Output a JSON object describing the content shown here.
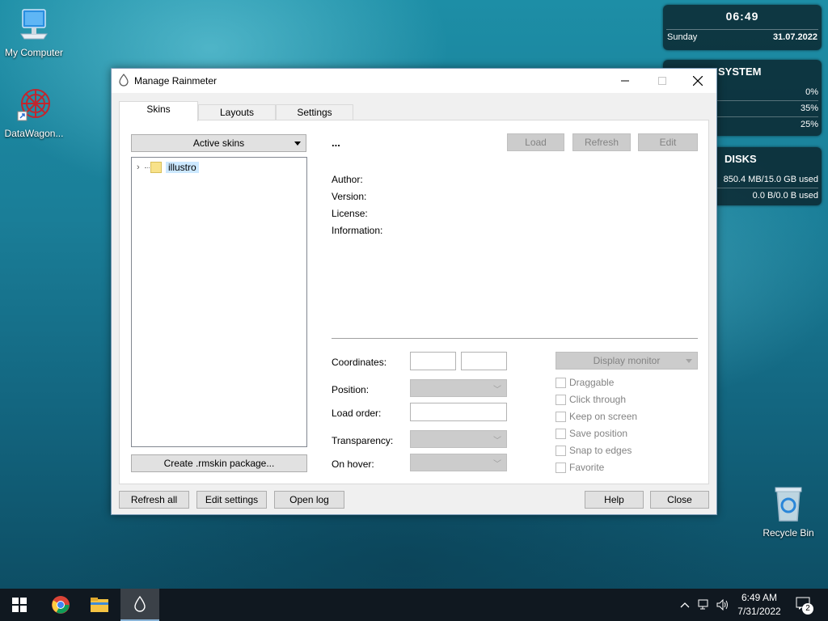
{
  "desktop": {
    "icons": [
      {
        "label": "My Computer"
      },
      {
        "label": "DataWagon..."
      },
      {
        "label": "Recycle Bin"
      }
    ]
  },
  "widgets": {
    "clock": {
      "time": "06:49",
      "day": "Sunday",
      "date": "31.07.2022"
    },
    "system": {
      "title": "SYSTEM",
      "values": [
        "0%",
        "35%",
        "25%"
      ]
    },
    "disks": {
      "title": "DISKS",
      "values": [
        "850.4 MB/15.0 GB used",
        "0.0 B/0.0 B used"
      ]
    }
  },
  "window": {
    "title": "Manage Rainmeter",
    "tabs": [
      {
        "label": "Skins",
        "active": true
      },
      {
        "label": "Layouts",
        "active": false
      },
      {
        "label": "Settings",
        "active": false
      }
    ],
    "skins": {
      "dropdown_label": "Active skins",
      "tree_items": [
        {
          "label": "illustro"
        }
      ],
      "create_package_label": "Create .rmskin package...",
      "skin_name": "...",
      "actions": {
        "load": "Load",
        "refresh": "Refresh",
        "edit": "Edit"
      },
      "info_labels": [
        "Author:",
        "Version:",
        "License:",
        "Information:"
      ],
      "fields": {
        "coordinates": "Coordinates:",
        "position": "Position:",
        "load_order": "Load order:",
        "transparency": "Transparency:",
        "on_hover": "On hover:"
      },
      "display_monitor": "Display monitor",
      "checkboxes": [
        "Draggable",
        "Click through",
        "Keep on screen",
        "Save position",
        "Snap to edges",
        "Favorite"
      ]
    },
    "footer": {
      "refresh_all": "Refresh all",
      "edit_settings": "Edit settings",
      "open_log": "Open log",
      "help": "Help",
      "close": "Close"
    }
  },
  "taskbar": {
    "time": "6:49 AM",
    "date": "7/31/2022",
    "notification_count": "2"
  },
  "colors": {
    "accent": "#0078d7",
    "tree_selection": "#cce8ff",
    "taskbar": "#101820"
  }
}
